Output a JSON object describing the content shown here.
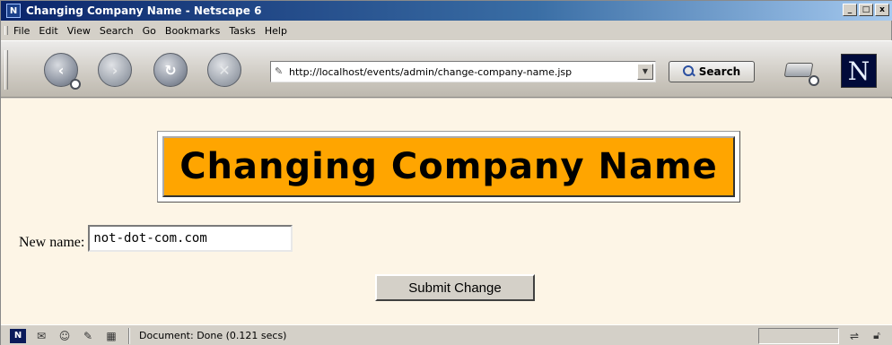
{
  "window": {
    "title": "Changing Company Name - Netscape 6",
    "app_icon_letter": "N",
    "controls": {
      "minimize": "_",
      "maximize": "□",
      "close": "x"
    }
  },
  "menu": {
    "items": [
      {
        "label": "File",
        "accel": "F"
      },
      {
        "label": "Edit",
        "accel": "E"
      },
      {
        "label": "View",
        "accel": "V"
      },
      {
        "label": "Search",
        "accel": "S"
      },
      {
        "label": "Go",
        "accel": "G"
      },
      {
        "label": "Bookmarks",
        "accel": "B"
      },
      {
        "label": "Tasks",
        "accel": "T"
      },
      {
        "label": "Help",
        "accel": "H"
      }
    ]
  },
  "toolbar": {
    "back_icon": "back-arrow-icon",
    "forward_icon": "forward-arrow-icon",
    "reload_icon": "reload-icon",
    "stop_icon": "stop-icon",
    "url": "http://localhost/events/admin/change-company-name.jsp",
    "search_label": "Search",
    "logo_letter": "N"
  },
  "page": {
    "heading": "Changing Company Name",
    "heading_bg": "#ffa500",
    "background": "#fdf5e6",
    "form": {
      "label": "New name:",
      "value": "not-dot-com.com",
      "submit_label": "Submit Change"
    }
  },
  "status": {
    "text": "Document: Done (0.121 secs)"
  }
}
